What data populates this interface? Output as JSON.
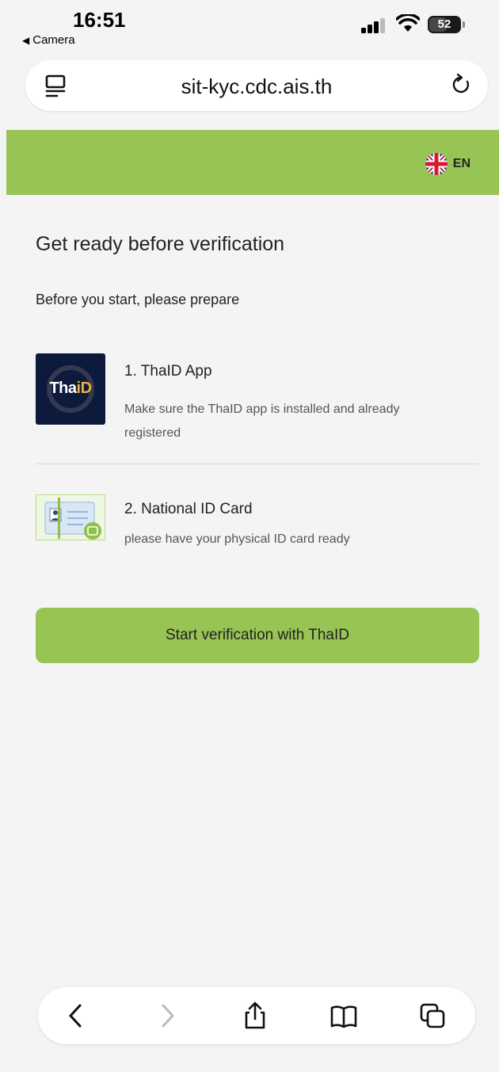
{
  "status_bar": {
    "time": "16:51",
    "back_app": "Camera",
    "battery": "52"
  },
  "browser": {
    "url": "sit-kyc.cdc.ais.th"
  },
  "header": {
    "language_label": "EN",
    "accent_color": "#97c454"
  },
  "main": {
    "title": "Get ready before verification",
    "subtitle": "Before you start, please prepare",
    "items": [
      {
        "title": "1. ThaID App",
        "description": "Make sure the ThaID app is installed and already registered",
        "logo_text_a": "Tha",
        "logo_text_b": "iD"
      },
      {
        "title": "2. National ID Card",
        "description": "please have your physical ID card ready"
      }
    ],
    "cta_label": "Start verification with ThaID"
  }
}
